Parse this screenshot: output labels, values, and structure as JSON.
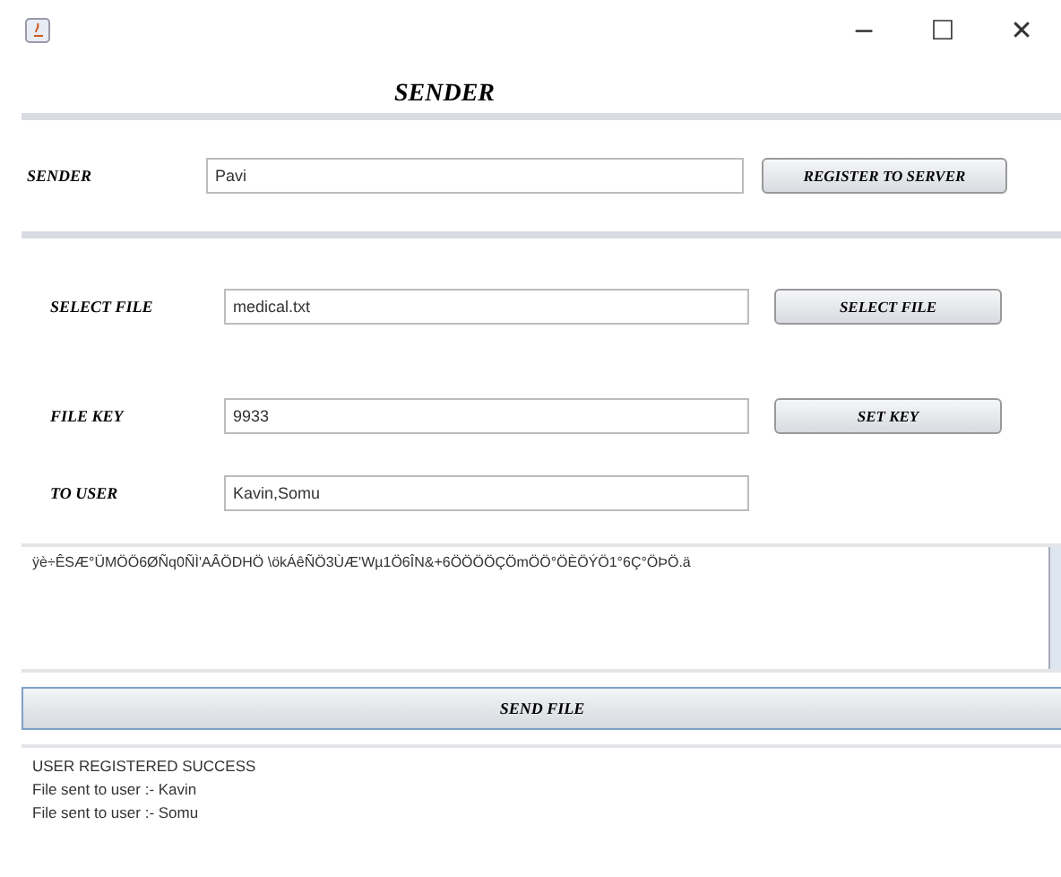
{
  "window": {
    "controls": [
      "−",
      "☐",
      "✕"
    ]
  },
  "title": "SENDER",
  "sender": {
    "label": "SENDER",
    "value": "Pavi",
    "button": "REGISTER TO SERVER"
  },
  "fields": [
    {
      "label": "SELECT FILE",
      "value": "medical.txt",
      "button": "SELECT FILE"
    },
    {
      "label": "FILE KEY",
      "value": "9933",
      "button": "SET KEY"
    },
    {
      "label": "TO USER",
      "value": "Kavin,Somu"
    }
  ],
  "encrypted_text": "ÿè÷ÊSÆ°ÜMÖÖ6ØÑq0ÑÌ'AÂÖDHÖ \\ökÁêÑÖ3ÙÆ'Wµ1Ö6ÎN&+6ÖÖÖÖÇÖmÖÖ°ÖÈÖÝÖ1°6Ç°ÖÞÖ.ä",
  "send_button": "SEND FILE",
  "log": [
    "USER REGISTERED SUCCESS",
    "File sent to user :- Kavin",
    "File sent to user :- Somu"
  ]
}
